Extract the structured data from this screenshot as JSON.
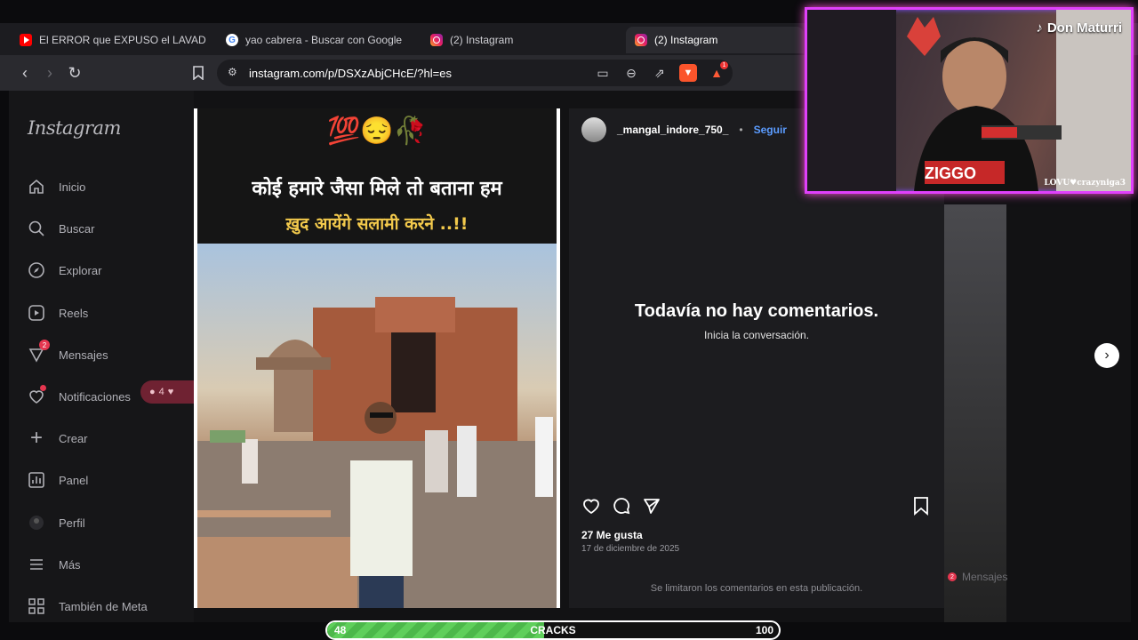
{
  "browser": {
    "tabs": [
      {
        "label": "El ERROR que EXPUSO el LAVADO de",
        "icon": "youtube-icon"
      },
      {
        "label": "yao cabrera - Buscar con Google",
        "icon": "google-icon"
      },
      {
        "label": "(2) Instagram",
        "icon": "instagram-icon"
      },
      {
        "label": "(2) Instagram",
        "icon": "instagram-icon"
      }
    ],
    "url": "instagram.com/p/DSXzAbjCHcE/?hl=es",
    "shield_badge": "1"
  },
  "sidebar": {
    "logo": "Instagram",
    "items": [
      {
        "label": "Inicio",
        "icon": "home-icon"
      },
      {
        "label": "Buscar",
        "icon": "search-icon"
      },
      {
        "label": "Explorar",
        "icon": "compass-icon"
      },
      {
        "label": "Reels",
        "icon": "reels-icon"
      },
      {
        "label": "Mensajes",
        "icon": "messenger-icon",
        "badge": "2"
      },
      {
        "label": "Notificaciones",
        "icon": "heart-icon"
      },
      {
        "label": "Crear",
        "icon": "plus-icon"
      },
      {
        "label": "Panel",
        "icon": "chart-icon"
      },
      {
        "label": "Perfil",
        "icon": "avatar-icon"
      },
      {
        "label": "Más",
        "icon": "menu-icon"
      },
      {
        "label": "También de Meta",
        "icon": "meta-icon"
      }
    ],
    "notif_count": "4"
  },
  "post": {
    "emojis": "💯😔🥀",
    "caption_line1": "कोई हमारे जैसा मिले तो बताना हम",
    "caption_line2": "ख़ुद आयेंगे सलामी करने ..!!",
    "username": "_mangal_indore_750_",
    "separator": "•",
    "follow": "Seguir",
    "empty_title": "Todavía no hay comentarios.",
    "empty_subtitle": "Inicia la conversación.",
    "likes": "27 Me gusta",
    "date": "17 de diciembre de 2025",
    "limited_comments": "Se limitaron los comentarios en esta publicación."
  },
  "floating": {
    "mensajes": "Mensajes",
    "mensajes_badge": "2"
  },
  "overlay": {
    "streamer_name": "Don Maturri",
    "cam_tag": "LOVU♥crazyniga3",
    "shirt_text": "ZIGGO"
  },
  "progress": {
    "min": "48",
    "label": "CRACKS",
    "max": "100",
    "fraction": 0.48
  }
}
